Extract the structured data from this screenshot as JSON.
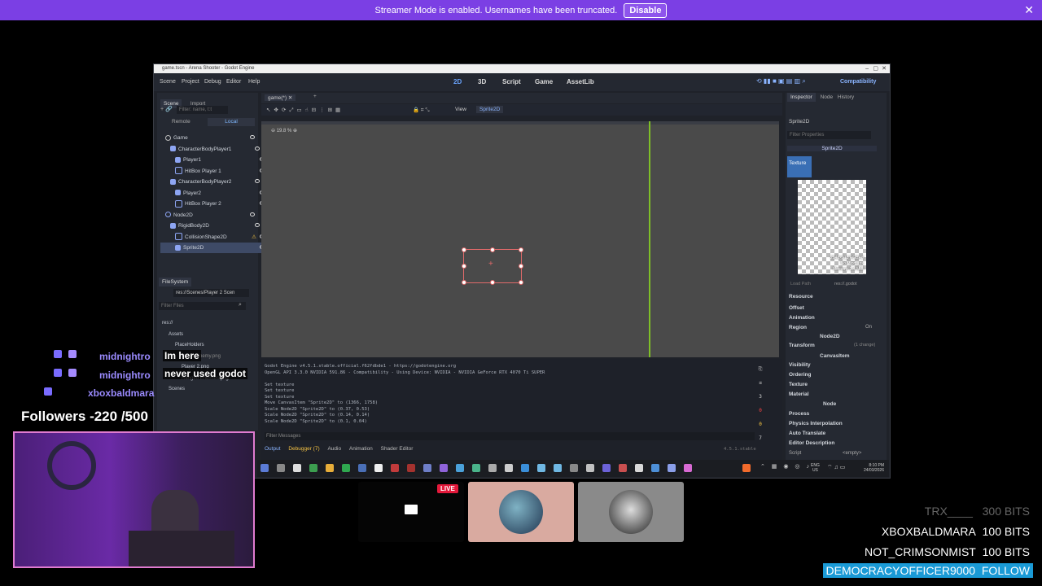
{
  "banner": {
    "text": "Streamer Mode is enabled. Usernames have been truncated.",
    "button": "Disable",
    "close": "✕"
  },
  "window": {
    "title": "game.tscn - Arena Shooter - Godot Engine",
    "controls": [
      "–",
      "▢",
      "✕"
    ]
  },
  "menu": [
    "Scene",
    "Project",
    "Debug",
    "Editor",
    "Help"
  ],
  "workspaces": [
    "2D",
    "3D",
    "Script",
    "Game",
    "AssetLib"
  ],
  "renderer": "Compatibility",
  "scene_dock": {
    "tabs": [
      "Scene",
      "Import"
    ],
    "filter_placeholder": "Filter: name, t:t",
    "remote": "Remote",
    "local": "Local",
    "nodes": [
      "Game",
      "CharacterBodyPlayer1",
      "Player1",
      "HitBox Player 1",
      "CharacterBodyPlayer2",
      "Player2",
      "HitBox Player 2",
      "Node2D",
      "RigidBody2D",
      "CollisionShape2D",
      "Sprite2D"
    ]
  },
  "filesystem": {
    "title": "FileSystem",
    "path": "res://Scenes/Player 2 Scen",
    "filter_placeholder": "Filter Files",
    "items": [
      "res://",
      "Assets",
      "PlaceHolders",
      "Melee Enemy.png",
      "Player 2.png",
      "Ranged Enemies.png",
      "Scenes"
    ]
  },
  "editor_tabs": {
    "tab": "game(*)",
    "view": "View",
    "node": "Sprite2D",
    "zoom": "19.8 %"
  },
  "output": {
    "lines": [
      "Godot Engine v4.5.1.stable.official.f62fdbde1 - https://godotengine.org",
      "OpenGL API 3.3.0 NVIDIA 591.86 - Compatibility - Using Device: NVIDIA - NVIDIA GeForce RTX 4070 Ti SUPER",
      "",
      "Set texture",
      "Set texture",
      "Set texture",
      "Move CanvasItem \"Sprite2D\" to (1366, 1758)",
      "Scale Node2D \"Sprite2D\" to (0.37, 0.53)",
      "Scale Node2D \"Sprite2D\" to (0.14, 0.14)",
      "Scale Node2D \"Sprite2D\" to (0.1, 0.04)"
    ],
    "filter_placeholder": "Filter Messages",
    "tabs": [
      "Output",
      "Debugger (7)",
      "Audio",
      "Animation",
      "Shader Editor"
    ],
    "version": "4.5.1.stable",
    "counts": [
      "3",
      "0",
      "0",
      "7"
    ]
  },
  "inspector": {
    "tabs": [
      "Inspector",
      "Node",
      "History"
    ],
    "node": "Sprite2D",
    "filter_placeholder": "Filter Properties",
    "class": "Sprite2D",
    "texture_label": "Texture",
    "tex_info": [
      "2048×913 RGBA8",
      "No Mipmaps",
      "Memory: 2.4 MiB"
    ],
    "load_path": "Load Path",
    "load_path_val": "res://.godot",
    "rows": [
      "Resource",
      "Offset",
      "Animation",
      "Region"
    ],
    "region_val": "On",
    "node2d_class": "Node2D",
    "transform": "Transform",
    "transform_changes": "(1 change)",
    "canvas_class": "CanvasItem",
    "canvas_rows": [
      "Visibility",
      "Ordering",
      "Texture",
      "Material"
    ],
    "node_class": "Node",
    "node_rows": [
      "Process",
      "Physics Interpolation",
      "Auto Translate",
      "Editor Description"
    ],
    "script_label": "Script",
    "script_val": "<empty>"
  },
  "taskbar": {
    "lang": "ENG",
    "region": "US",
    "time": "8:10 PM",
    "date": "24/03/2026"
  },
  "chat": [
    {
      "user": "midnightro",
      "msg": "Im here"
    },
    {
      "user": "midnightro",
      "msg": "never used godot"
    },
    {
      "user": "xboxbaldmara",
      "msg": ""
    }
  ],
  "followers": "Followers -220 /500",
  "live_badge": "LIVE",
  "bits": [
    {
      "name": "TRX____",
      "amount": "300 BITS"
    },
    {
      "name": "XBOXBALDMARA",
      "amount": "100 BITS"
    },
    {
      "name": "NOT_CRIMSONMIST",
      "amount": "100 BITS"
    },
    {
      "name": "DEMOCRACYOFFICER9000",
      "amount": "FOLLOW"
    }
  ],
  "colors": {
    "accent": "#7b3fe4",
    "godot_bg": "#1f2229",
    "guide": "#7fbf27",
    "selection": "#e06a6a"
  }
}
